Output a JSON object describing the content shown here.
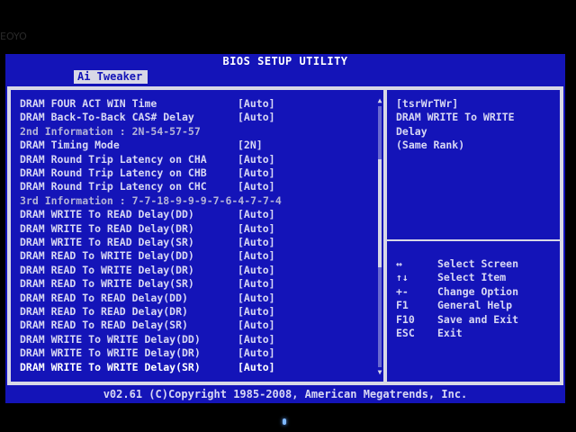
{
  "window": {
    "title": "BIOS SETUP UTILITY",
    "active_tab": "Ai Tweaker"
  },
  "bezel": {
    "logo_text": "EOYO"
  },
  "settings": [
    {
      "label": "DRAM FOUR ACT WIN Time",
      "value": "[Auto]",
      "kind": "setting"
    },
    {
      "label": "DRAM Back-To-Back CAS# Delay",
      "value": "[Auto]",
      "kind": "setting"
    },
    {
      "label": "2nd Information : 2N-54-57-57",
      "value": "",
      "kind": "info"
    },
    {
      "label": "DRAM Timing Mode",
      "value": "[2N]",
      "kind": "setting"
    },
    {
      "label": "DRAM Round Trip Latency on CHA",
      "value": "[Auto]",
      "kind": "setting"
    },
    {
      "label": "DRAM Round Trip Latency on CHB",
      "value": "[Auto]",
      "kind": "setting"
    },
    {
      "label": "DRAM Round Trip Latency on CHC",
      "value": "[Auto]",
      "kind": "setting"
    },
    {
      "label": "3rd Information : 7-7-18-9-9-9-7-6-4-7-7-4",
      "value": "",
      "kind": "info"
    },
    {
      "label": "DRAM WRITE To READ Delay(DD)",
      "value": "[Auto]",
      "kind": "setting"
    },
    {
      "label": "DRAM WRITE To READ Delay(DR)",
      "value": "[Auto]",
      "kind": "setting"
    },
    {
      "label": "DRAM WRITE To READ Delay(SR)",
      "value": "[Auto]",
      "kind": "setting"
    },
    {
      "label": "DRAM READ To WRITE Delay(DD)",
      "value": "[Auto]",
      "kind": "setting"
    },
    {
      "label": "DRAM READ To WRITE Delay(DR)",
      "value": "[Auto]",
      "kind": "setting"
    },
    {
      "label": "DRAM READ To WRITE Delay(SR)",
      "value": "[Auto]",
      "kind": "setting"
    },
    {
      "label": "DRAM READ To READ Delay(DD)",
      "value": "[Auto]",
      "kind": "setting"
    },
    {
      "label": "DRAM READ To READ Delay(DR)",
      "value": "[Auto]",
      "kind": "setting"
    },
    {
      "label": "DRAM READ To READ Delay(SR)",
      "value": "[Auto]",
      "kind": "setting"
    },
    {
      "label": "DRAM WRITE To WRITE Delay(DD)",
      "value": "[Auto]",
      "kind": "setting"
    },
    {
      "label": "DRAM WRITE To WRITE Delay(DR)",
      "value": "[Auto]",
      "kind": "setting"
    },
    {
      "label": "DRAM WRITE To WRITE Delay(SR)",
      "value": "[Auto]",
      "kind": "selected"
    }
  ],
  "scroll_position": 0.35,
  "help": {
    "lines": [
      "[tsrWrTWr]",
      "DRAM WRITE To WRITE",
      "Delay",
      "(Same Rank)"
    ]
  },
  "keys": [
    {
      "key": "↔",
      "desc": "Select Screen"
    },
    {
      "key": "↑↓",
      "desc": "Select Item"
    },
    {
      "key": "+-",
      "desc": "Change Option"
    },
    {
      "key": "F1",
      "desc": "General Help"
    },
    {
      "key": "F10",
      "desc": "Save and Exit"
    },
    {
      "key": "ESC",
      "desc": "Exit"
    }
  ],
  "footer": "v02.61 (C)Copyright 1985-2008, American Megatrends, Inc.",
  "colors": {
    "background": "#1414b8",
    "frame": "#d8d8e6",
    "text": "#d8d8f4",
    "selected_text": "#ffffff"
  }
}
